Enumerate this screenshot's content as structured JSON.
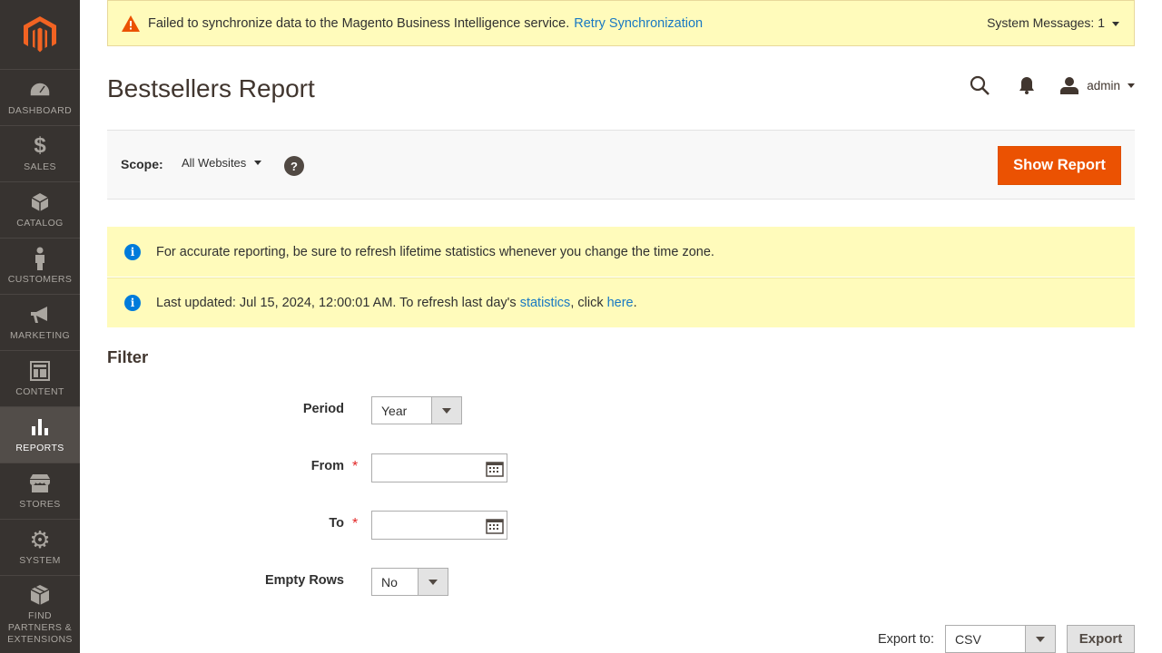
{
  "sidebar": {
    "items": [
      {
        "label": "Dashboard",
        "icon": "dashboard-icon"
      },
      {
        "label": "Sales",
        "icon": "dollar-icon"
      },
      {
        "label": "Catalog",
        "icon": "cube-icon"
      },
      {
        "label": "Customers",
        "icon": "person-icon"
      },
      {
        "label": "Marketing",
        "icon": "megaphone-icon"
      },
      {
        "label": "Content",
        "icon": "layout-icon"
      },
      {
        "label": "Reports",
        "icon": "bar-chart-icon",
        "active": true
      },
      {
        "label": "Stores",
        "icon": "store-icon"
      },
      {
        "label": "System",
        "icon": "gear-icon"
      },
      {
        "label": "Find Partners & Extensions",
        "icon": "blocks-icon"
      }
    ]
  },
  "system_message": {
    "text": "Failed to synchronize data to the Magento Business Intelligence service.",
    "link": "Retry Synchronization",
    "count_label": "System Messages: 1"
  },
  "header": {
    "title": "Bestsellers Report",
    "user": "admin"
  },
  "scope": {
    "label": "Scope:",
    "value": "All Websites",
    "help": "?",
    "show_report": "Show Report"
  },
  "notices": {
    "first": "For accurate reporting, be sure to refresh lifetime statistics whenever you change the time zone.",
    "second_prefix": "Last updated: Jul 15, 2024, 12:00:01 AM. To refresh last day's ",
    "second_link1": "statistics",
    "second_mid": ", click ",
    "second_link2": "here",
    "second_suffix": "."
  },
  "filter": {
    "title": "Filter",
    "period_label": "Period",
    "period_value": "Year",
    "from_label": "From",
    "from_value": "",
    "to_label": "To",
    "to_value": "",
    "empty_rows_label": "Empty Rows",
    "empty_rows_value": "No",
    "required_mark": "*"
  },
  "export": {
    "label": "Export to:",
    "format": "CSV",
    "button": "Export"
  },
  "colors": {
    "sidebar_bg": "#373330",
    "accent": "#eb5202",
    "notice_bg": "#fffbbb",
    "link": "#1979c3"
  }
}
